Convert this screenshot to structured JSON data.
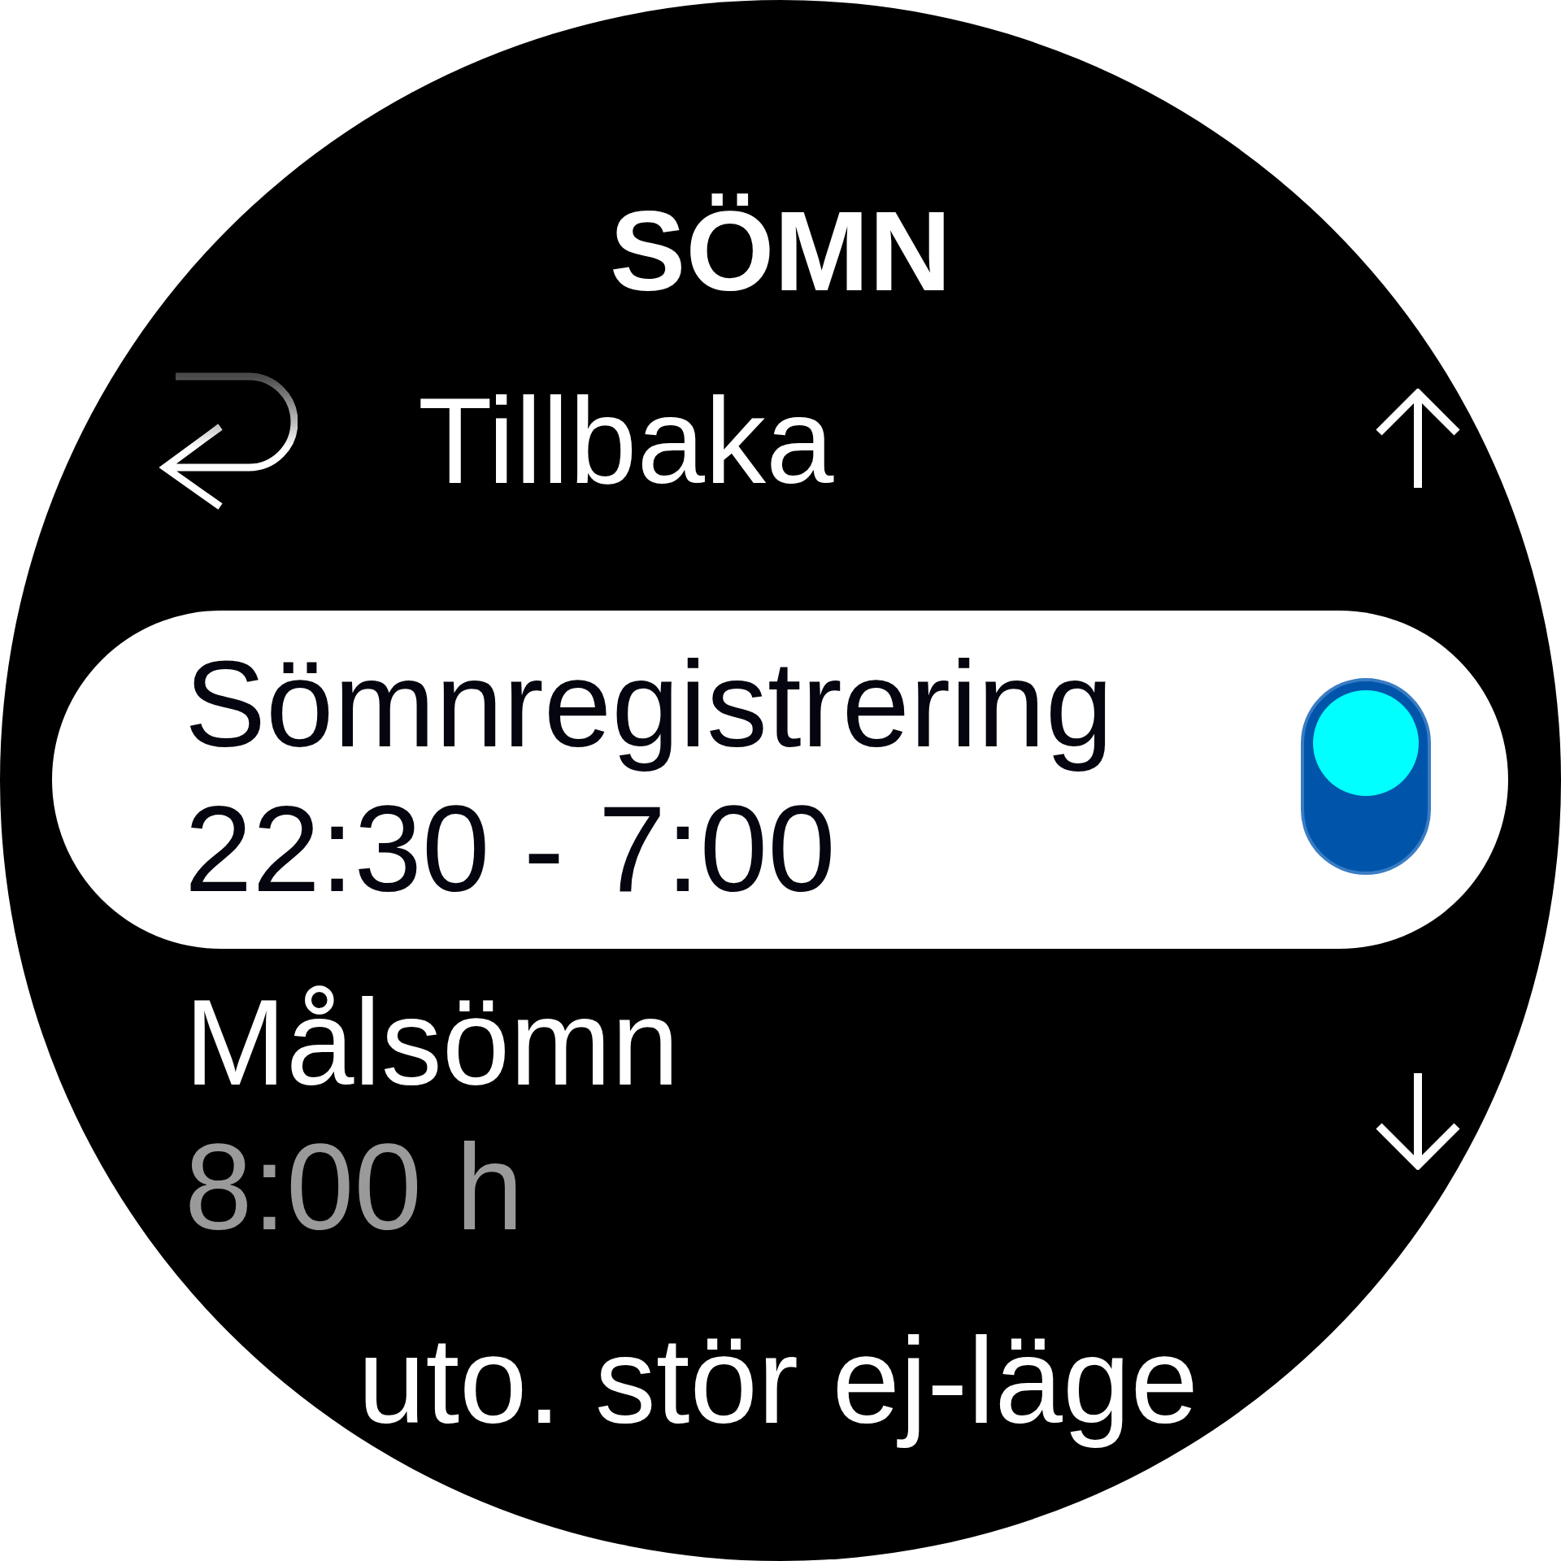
{
  "title": "SÖMN",
  "back": {
    "label": "Tillbaka"
  },
  "items": [
    {
      "kind": "toggle",
      "label": "Sömnregistrering",
      "value": "22:30 - 7:00",
      "selected": true,
      "on": true
    },
    {
      "kind": "value",
      "label": "Målsömn",
      "value": "8:00 h",
      "selected": false
    },
    {
      "kind": "plain",
      "label": "uto. stör ej-läge",
      "selected": false
    }
  ]
}
